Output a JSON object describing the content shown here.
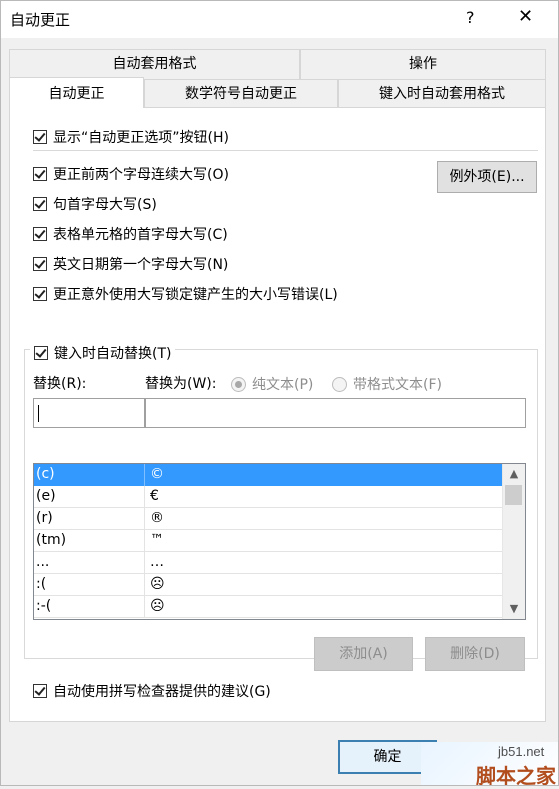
{
  "window": {
    "title": "自动更正",
    "help_glyph": "?",
    "close_glyph": "✕"
  },
  "tabs": [
    {
      "label": "自动套用格式"
    },
    {
      "label": "操作"
    },
    {
      "label": "自动更正"
    },
    {
      "label": "数学符号自动更正"
    },
    {
      "label": "键入时自动套用格式"
    }
  ],
  "options": {
    "show_buttons": "显示“自动更正选项”按钮(H)",
    "two_initial_caps": "更正前两个字母连续大写(O)",
    "exceptions_button": "例外项(E)...",
    "capitalize_sentence": "句首字母大写(S)",
    "capitalize_table_cell": "表格单元格的首字母大写(C)",
    "capitalize_days": "英文日期第一个字母大写(N)",
    "caps_lock_fix": "更正意外使用大写锁定键产生的大小写错误(L)"
  },
  "replace_group": {
    "enable_label": "键入时自动替换(T)",
    "replace_label": "替换(R):",
    "with_label": "替换为(W):",
    "plain_text": "纯文本(P)",
    "formatted_text": "带格式文本(F)",
    "replace_value": "",
    "with_value": ""
  },
  "entries": [
    {
      "replace": "(c)",
      "with": "©"
    },
    {
      "replace": "(e)",
      "with": "€"
    },
    {
      "replace": "(r)",
      "with": "®"
    },
    {
      "replace": "(tm)",
      "with": "™"
    },
    {
      "replace": "...",
      "with": "…"
    },
    {
      "replace": ":(",
      "with": "☹"
    },
    {
      "replace": ":-(",
      "with": "☹"
    }
  ],
  "buttons": {
    "add": "添加(A)",
    "delete": "删除(D)",
    "spell_suggest": "自动使用拼写检查器提供的建议(G)",
    "ok": "确定"
  },
  "watermark": {
    "site": "jb51.net",
    "brand": "脚本之家"
  }
}
